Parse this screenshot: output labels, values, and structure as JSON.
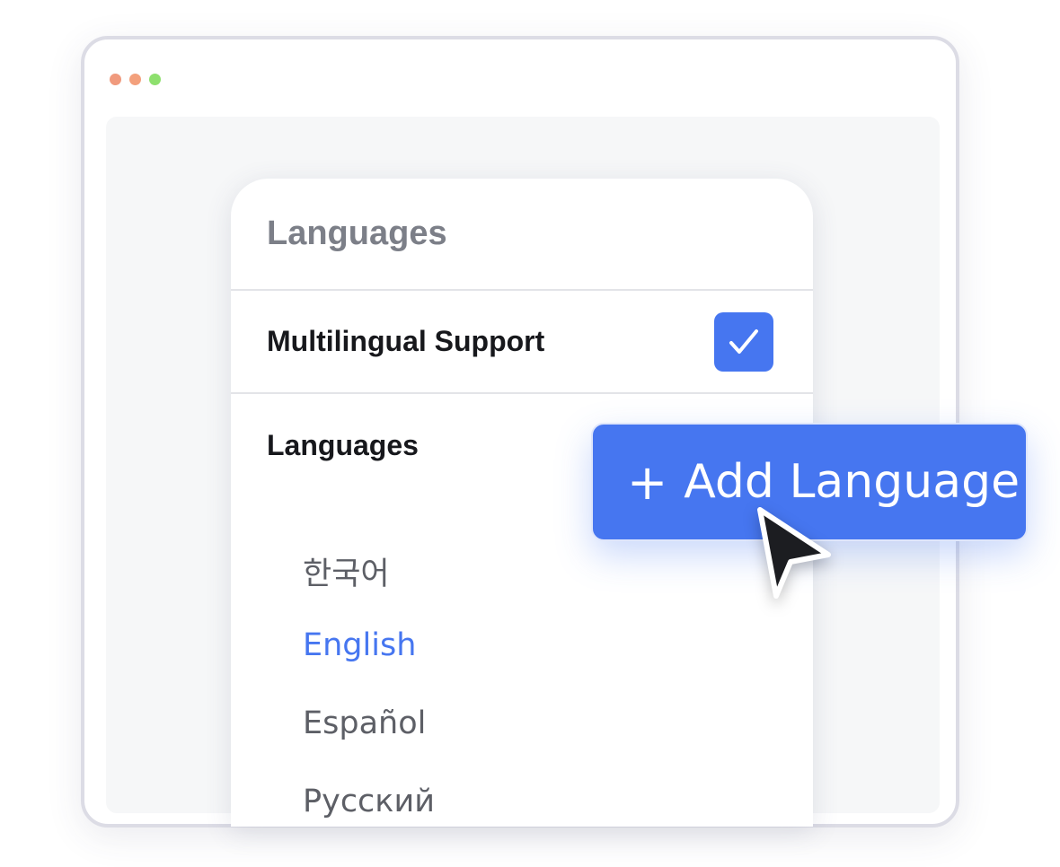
{
  "window": {
    "controls": [
      {
        "name": "close",
        "color": "#f09a7d"
      },
      {
        "name": "minimize",
        "color": "#f3a07c"
      },
      {
        "name": "maximize",
        "color": "#8ee06e"
      }
    ]
  },
  "panel": {
    "title": "Languages",
    "multilingual": {
      "label": "Multilingual Support",
      "checked": true
    },
    "languages_section": {
      "label": "Languages",
      "items": [
        {
          "label": "한국어",
          "active": false
        },
        {
          "label": "English",
          "active": true
        },
        {
          "label": "Español",
          "active": false
        },
        {
          "label": "Русский",
          "active": false
        }
      ]
    }
  },
  "add_button": {
    "plus_icon": "+",
    "label": "Add Language"
  },
  "colors": {
    "accent": "#4676f0",
    "heading": "#7c7f88",
    "text_dark": "#17181c",
    "text_muted": "#5d5f66"
  }
}
